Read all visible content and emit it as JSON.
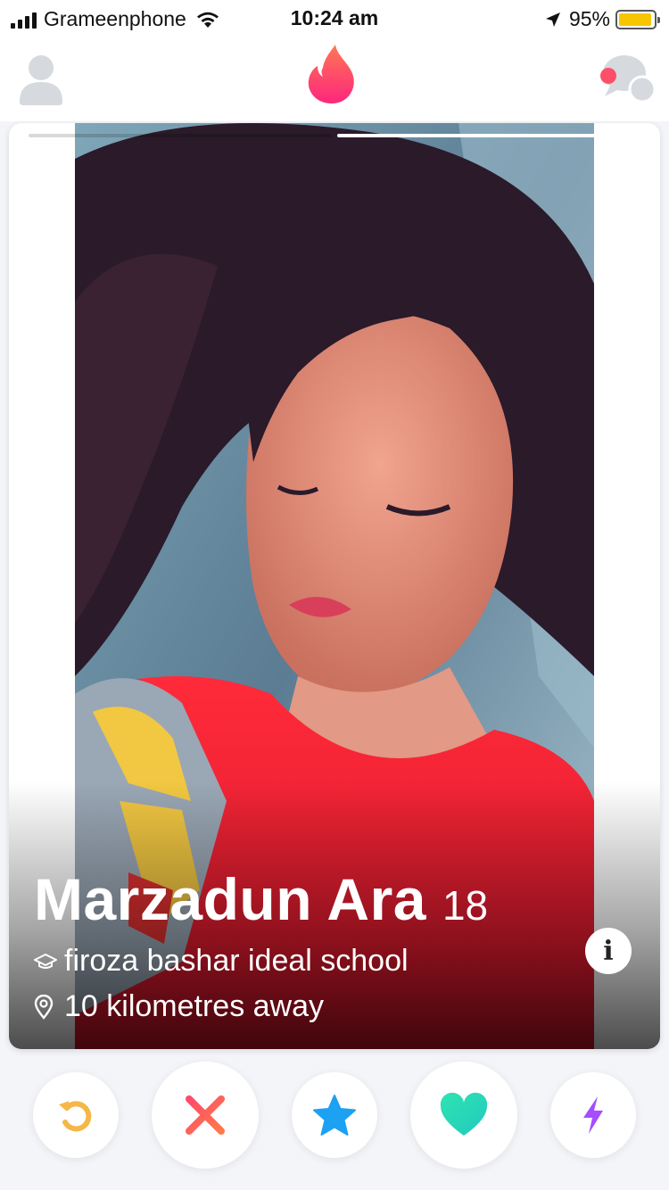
{
  "status_bar": {
    "carrier": "Grameenphone",
    "time": "10:24 am",
    "battery_percent": "95%",
    "battery_level": 0.95,
    "battery_color": "#f7c600",
    "icons": [
      "signal-icon",
      "wifi-icon",
      "location-arrow-icon",
      "battery-icon"
    ]
  },
  "top_nav": {
    "left_icon": "profile-icon",
    "center_icon": "tinder-flame-icon",
    "right_icon": "messages-icon",
    "brand_color": "#fe3c72",
    "notification_dot_color": "#fd5068"
  },
  "card": {
    "photo_count": 2,
    "active_photo": 2,
    "name": "Marzadun Ara",
    "age": "18",
    "school": "firoza bashar ideal school",
    "distance": "10 kilometres away",
    "school_icon": "graduation-cap-icon",
    "distance_icon": "location-pin-icon",
    "info_button_label": "i"
  },
  "actions": [
    {
      "name": "rewind-button",
      "icon": "rewind-icon",
      "color": "#f5b748"
    },
    {
      "name": "nope-button",
      "icon": "x-icon",
      "color": "#fd5068"
    },
    {
      "name": "super-like-button",
      "icon": "star-icon",
      "color": "#1da1f2"
    },
    {
      "name": "like-button",
      "icon": "heart-icon",
      "color": "#2ee4b0"
    },
    {
      "name": "boost-button",
      "icon": "lightning-bolt-icon",
      "color": "#a64dff"
    }
  ]
}
